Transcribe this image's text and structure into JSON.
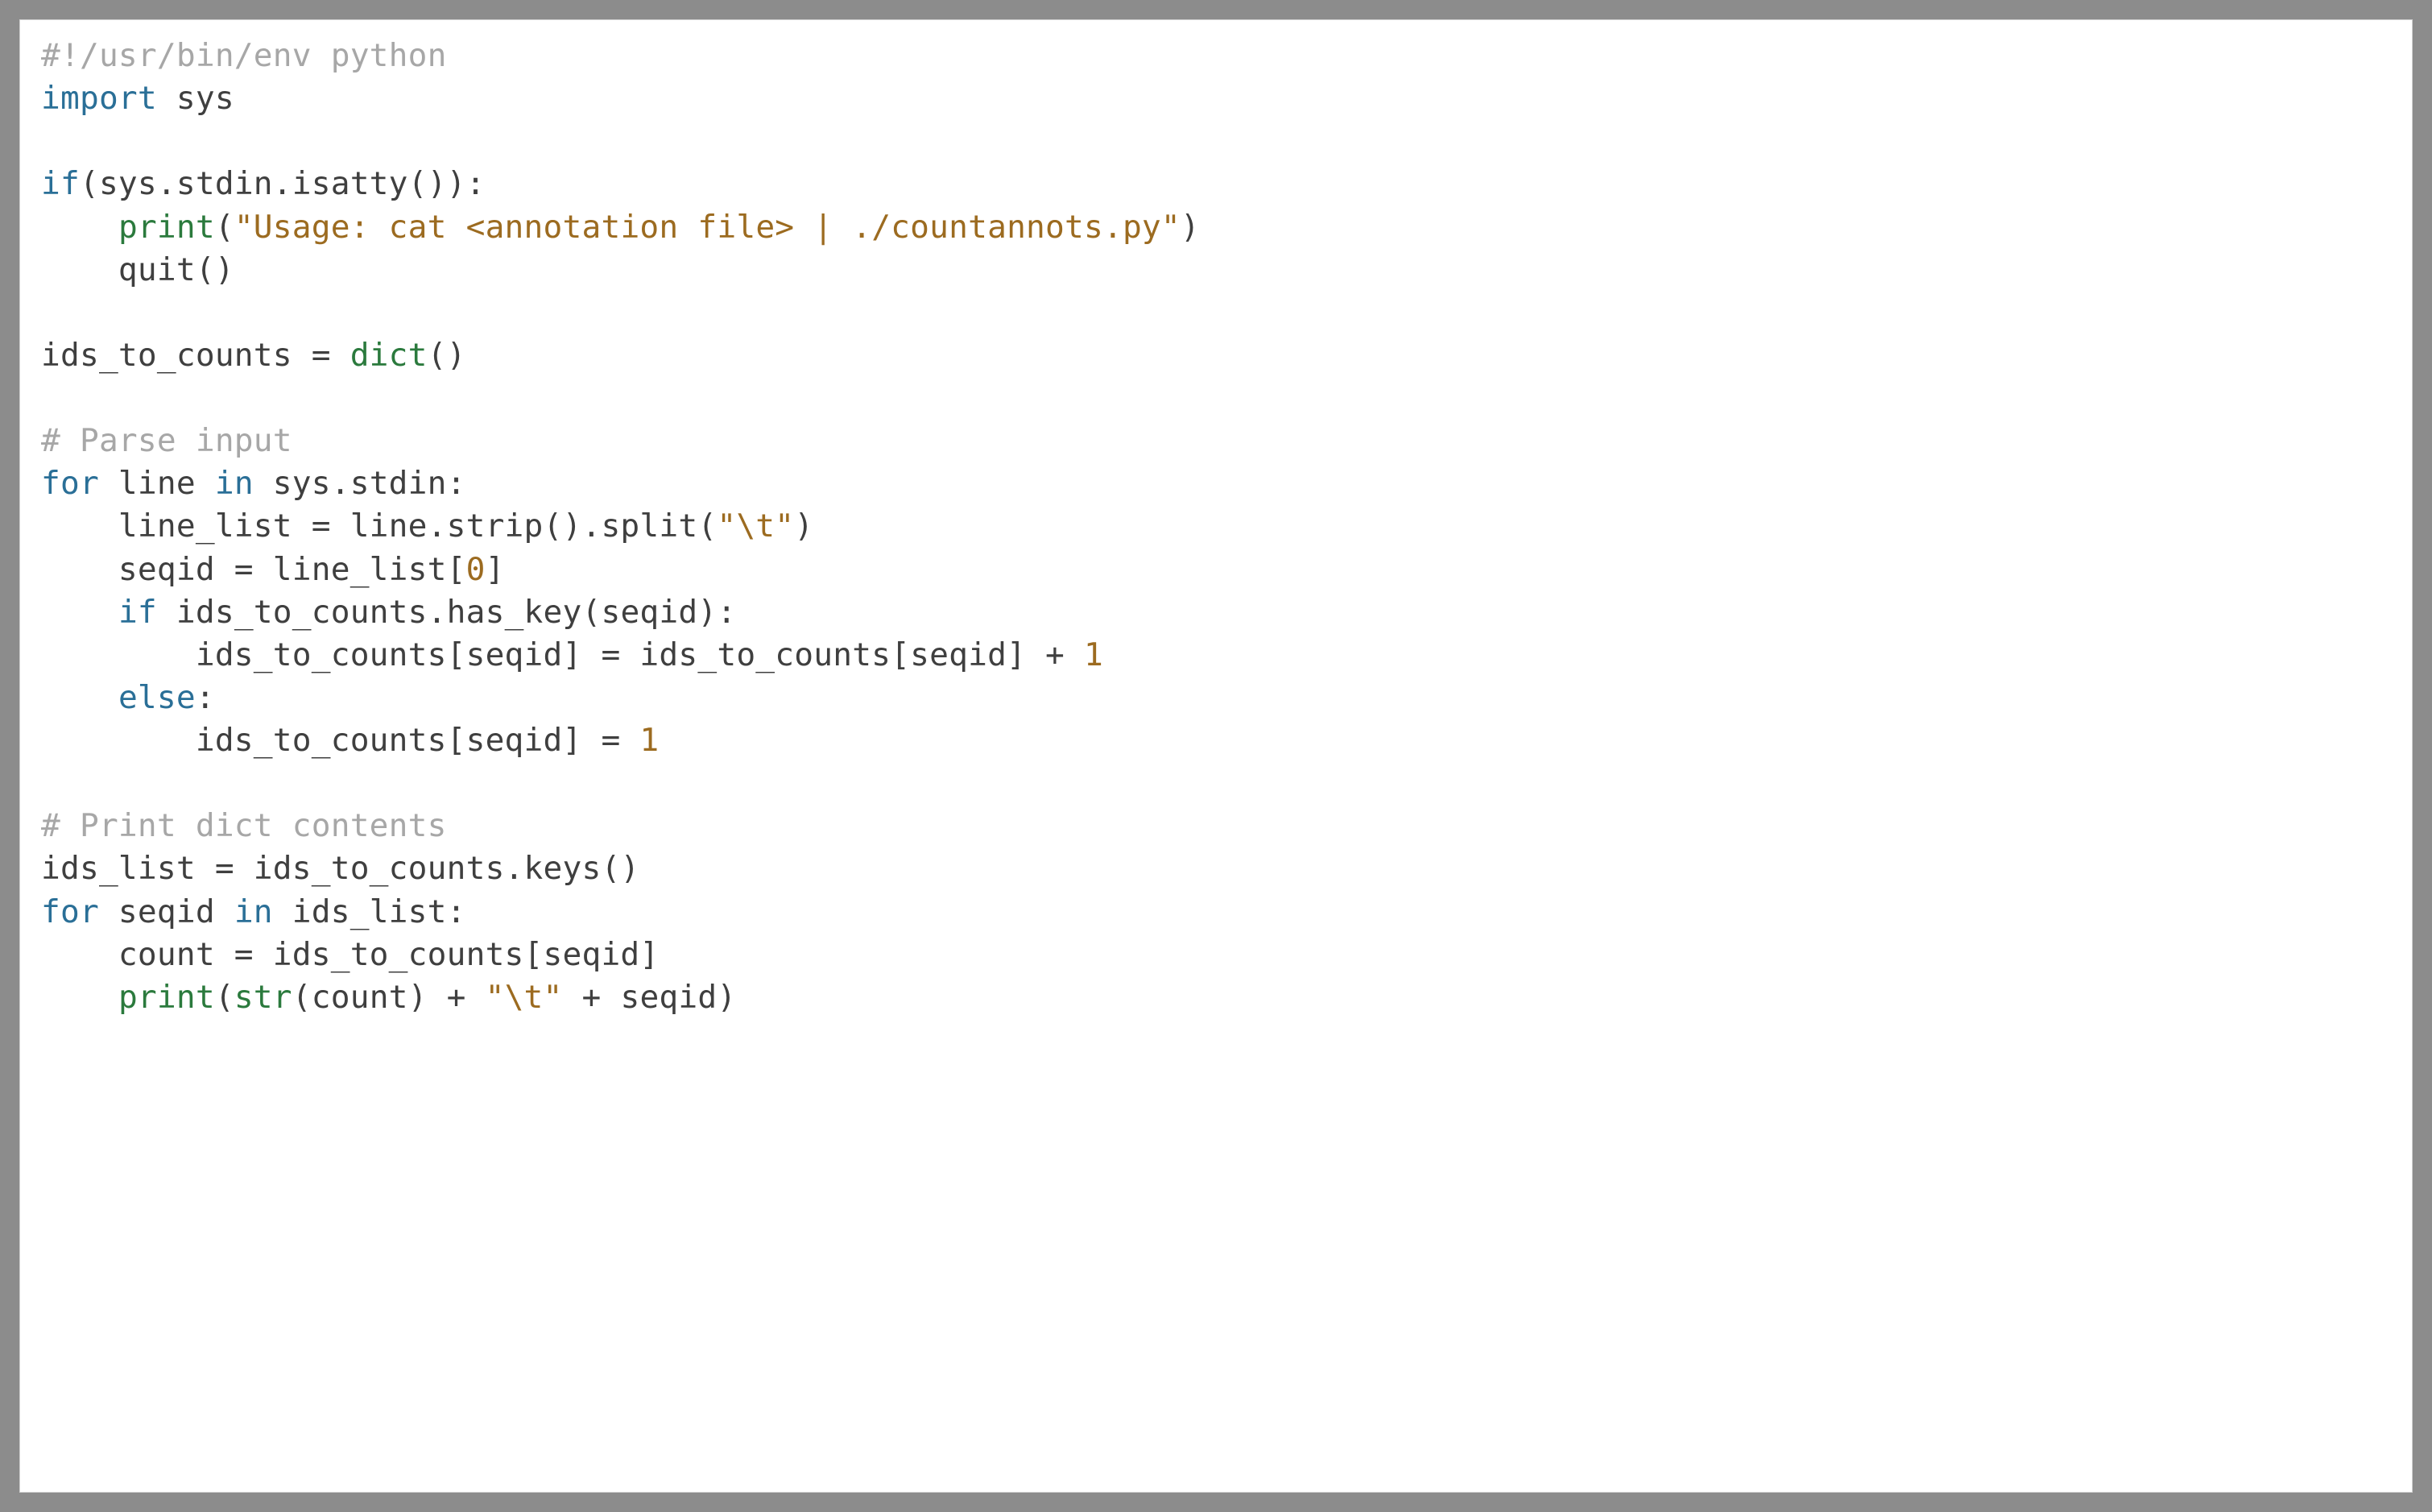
{
  "code": {
    "lines": [
      [
        {
          "cls": "tok-comment",
          "text": "#!/usr/bin/env python"
        }
      ],
      [
        {
          "cls": "tok-keyword",
          "text": "import"
        },
        {
          "cls": "tok-default",
          "text": " sys"
        }
      ],
      [
        {
          "cls": "tok-default",
          "text": ""
        }
      ],
      [
        {
          "cls": "tok-keyword",
          "text": "if"
        },
        {
          "cls": "tok-default",
          "text": "(sys.stdin.isatty()):"
        }
      ],
      [
        {
          "cls": "tok-default",
          "text": "    "
        },
        {
          "cls": "tok-builtin",
          "text": "print"
        },
        {
          "cls": "tok-default",
          "text": "("
        },
        {
          "cls": "tok-string",
          "text": "\"Usage: cat <annotation file> | ./countannots.py\""
        },
        {
          "cls": "tok-default",
          "text": ")"
        }
      ],
      [
        {
          "cls": "tok-default",
          "text": "    quit()"
        }
      ],
      [
        {
          "cls": "tok-default",
          "text": ""
        }
      ],
      [
        {
          "cls": "tok-default",
          "text": "ids_to_counts = "
        },
        {
          "cls": "tok-builtin",
          "text": "dict"
        },
        {
          "cls": "tok-default",
          "text": "()"
        }
      ],
      [
        {
          "cls": "tok-default",
          "text": ""
        }
      ],
      [
        {
          "cls": "tok-comment",
          "text": "# Parse input"
        }
      ],
      [
        {
          "cls": "tok-keyword",
          "text": "for"
        },
        {
          "cls": "tok-default",
          "text": " line "
        },
        {
          "cls": "tok-keyword",
          "text": "in"
        },
        {
          "cls": "tok-default",
          "text": " sys.stdin:"
        }
      ],
      [
        {
          "cls": "tok-default",
          "text": "    line_list = line.strip().split("
        },
        {
          "cls": "tok-string",
          "text": "\"\\t\""
        },
        {
          "cls": "tok-default",
          "text": ")"
        }
      ],
      [
        {
          "cls": "tok-default",
          "text": "    seqid = line_list["
        },
        {
          "cls": "tok-number",
          "text": "0"
        },
        {
          "cls": "tok-default",
          "text": "]"
        }
      ],
      [
        {
          "cls": "tok-default",
          "text": "    "
        },
        {
          "cls": "tok-keyword",
          "text": "if"
        },
        {
          "cls": "tok-default",
          "text": " ids_to_counts.has_key(seqid):"
        }
      ],
      [
        {
          "cls": "tok-default",
          "text": "        ids_to_counts[seqid] = ids_to_counts[seqid] + "
        },
        {
          "cls": "tok-number",
          "text": "1"
        }
      ],
      [
        {
          "cls": "tok-default",
          "text": "    "
        },
        {
          "cls": "tok-keyword",
          "text": "else"
        },
        {
          "cls": "tok-default",
          "text": ":"
        }
      ],
      [
        {
          "cls": "tok-default",
          "text": "        ids_to_counts[seqid] = "
        },
        {
          "cls": "tok-number",
          "text": "1"
        }
      ],
      [
        {
          "cls": "tok-default",
          "text": ""
        }
      ],
      [
        {
          "cls": "tok-comment",
          "text": "# Print dict contents"
        }
      ],
      [
        {
          "cls": "tok-default",
          "text": "ids_list = ids_to_counts.keys()"
        }
      ],
      [
        {
          "cls": "tok-keyword",
          "text": "for"
        },
        {
          "cls": "tok-default",
          "text": " seqid "
        },
        {
          "cls": "tok-keyword",
          "text": "in"
        },
        {
          "cls": "tok-default",
          "text": " ids_list:"
        }
      ],
      [
        {
          "cls": "tok-default",
          "text": "    count = ids_to_counts[seqid]"
        }
      ],
      [
        {
          "cls": "tok-default",
          "text": "    "
        },
        {
          "cls": "tok-builtin",
          "text": "print"
        },
        {
          "cls": "tok-default",
          "text": "("
        },
        {
          "cls": "tok-builtin",
          "text": "str"
        },
        {
          "cls": "tok-default",
          "text": "(count) + "
        },
        {
          "cls": "tok-string",
          "text": "\"\\t\""
        },
        {
          "cls": "tok-default",
          "text": " + seqid)"
        }
      ]
    ]
  }
}
